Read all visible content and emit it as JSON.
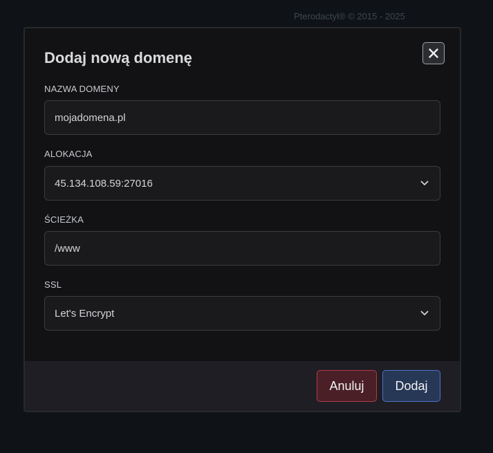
{
  "page": {
    "footer": "Pterodactyl® © 2015 - 2025"
  },
  "modal": {
    "title": "Dodaj nową domenę",
    "close_icon": "close-icon",
    "fields": {
      "domain": {
        "label": "NAZWA DOMENY",
        "value": "mojadomena.pl"
      },
      "allocation": {
        "label": "ALOKACJA",
        "value": "45.134.108.59:27016"
      },
      "path": {
        "label": "ŚCIEŻKA",
        "value": "/www"
      },
      "ssl": {
        "label": "SSL",
        "value": "Let's Encrypt"
      }
    },
    "buttons": {
      "cancel": "Anuluj",
      "add": "Dodaj"
    }
  },
  "colors": {
    "background": "#0f1317",
    "modal": "#121215",
    "cancel_border": "#b23b48",
    "add_border": "#4d74c8"
  }
}
